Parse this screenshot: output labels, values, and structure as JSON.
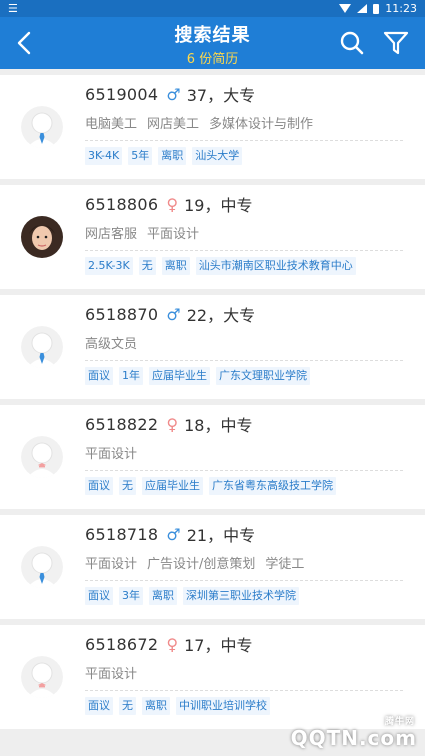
{
  "status_bar": {
    "time": "11:23"
  },
  "header": {
    "title": "搜索结果",
    "subtitle": "6 份简历"
  },
  "colors": {
    "nav": "#1f7ed6",
    "accent": "#ffd84a",
    "tag_text": "#2a7cc9",
    "tag_bg": "#eef5fd",
    "male": "#3a8fdc",
    "female": "#f08a8a"
  },
  "icons": {
    "back": "chevron-left-icon",
    "search": "search-icon",
    "filter": "filter-icon"
  },
  "resumes": [
    {
      "id": "6519004",
      "sex_symbol": "♂",
      "gender": "male",
      "age_edu": "37，大专",
      "avatar": "male-placeholder",
      "jobs": [
        "电脑美工",
        "网店美工",
        "多媒体设计与制作"
      ],
      "tags": [
        "3K-4K",
        "5年",
        "离职",
        "汕头大学"
      ]
    },
    {
      "id": "6518806",
      "sex_symbol": "♀",
      "gender": "female",
      "age_edu": "19，中专",
      "avatar": "photo",
      "jobs": [
        "网店客服",
        "平面设计"
      ],
      "tags": [
        "2.5K-3K",
        "无",
        "离职",
        "汕头市潮南区职业技术教育中心"
      ]
    },
    {
      "id": "6518870",
      "sex_symbol": "♂",
      "gender": "male",
      "age_edu": "22，大专",
      "avatar": "male-placeholder",
      "jobs": [
        "高级文员"
      ],
      "tags": [
        "面议",
        "1年",
        "应届毕业生",
        "广东文理职业学院"
      ]
    },
    {
      "id": "6518822",
      "sex_symbol": "♀",
      "gender": "female",
      "age_edu": "18，中专",
      "avatar": "female-placeholder",
      "jobs": [
        "平面设计"
      ],
      "tags": [
        "面议",
        "无",
        "应届毕业生",
        "广东省粤东高级技工学院"
      ]
    },
    {
      "id": "6518718",
      "sex_symbol": "♂",
      "gender": "male",
      "age_edu": "21，中专",
      "avatar": "male-placeholder",
      "jobs": [
        "平面设计",
        "广告设计/创意策划",
        "学徒工"
      ],
      "tags": [
        "面议",
        "3年",
        "离职",
        "深圳第三职业技术学院"
      ]
    },
    {
      "id": "6518672",
      "sex_symbol": "♀",
      "gender": "female",
      "age_edu": "17，中专",
      "avatar": "female-placeholder",
      "jobs": [
        "平面设计"
      ],
      "tags": [
        "面议",
        "无",
        "离职",
        "中训职业培训学校"
      ]
    }
  ],
  "watermark": {
    "text": "QQTN.com",
    "sub": "腾牛网"
  }
}
